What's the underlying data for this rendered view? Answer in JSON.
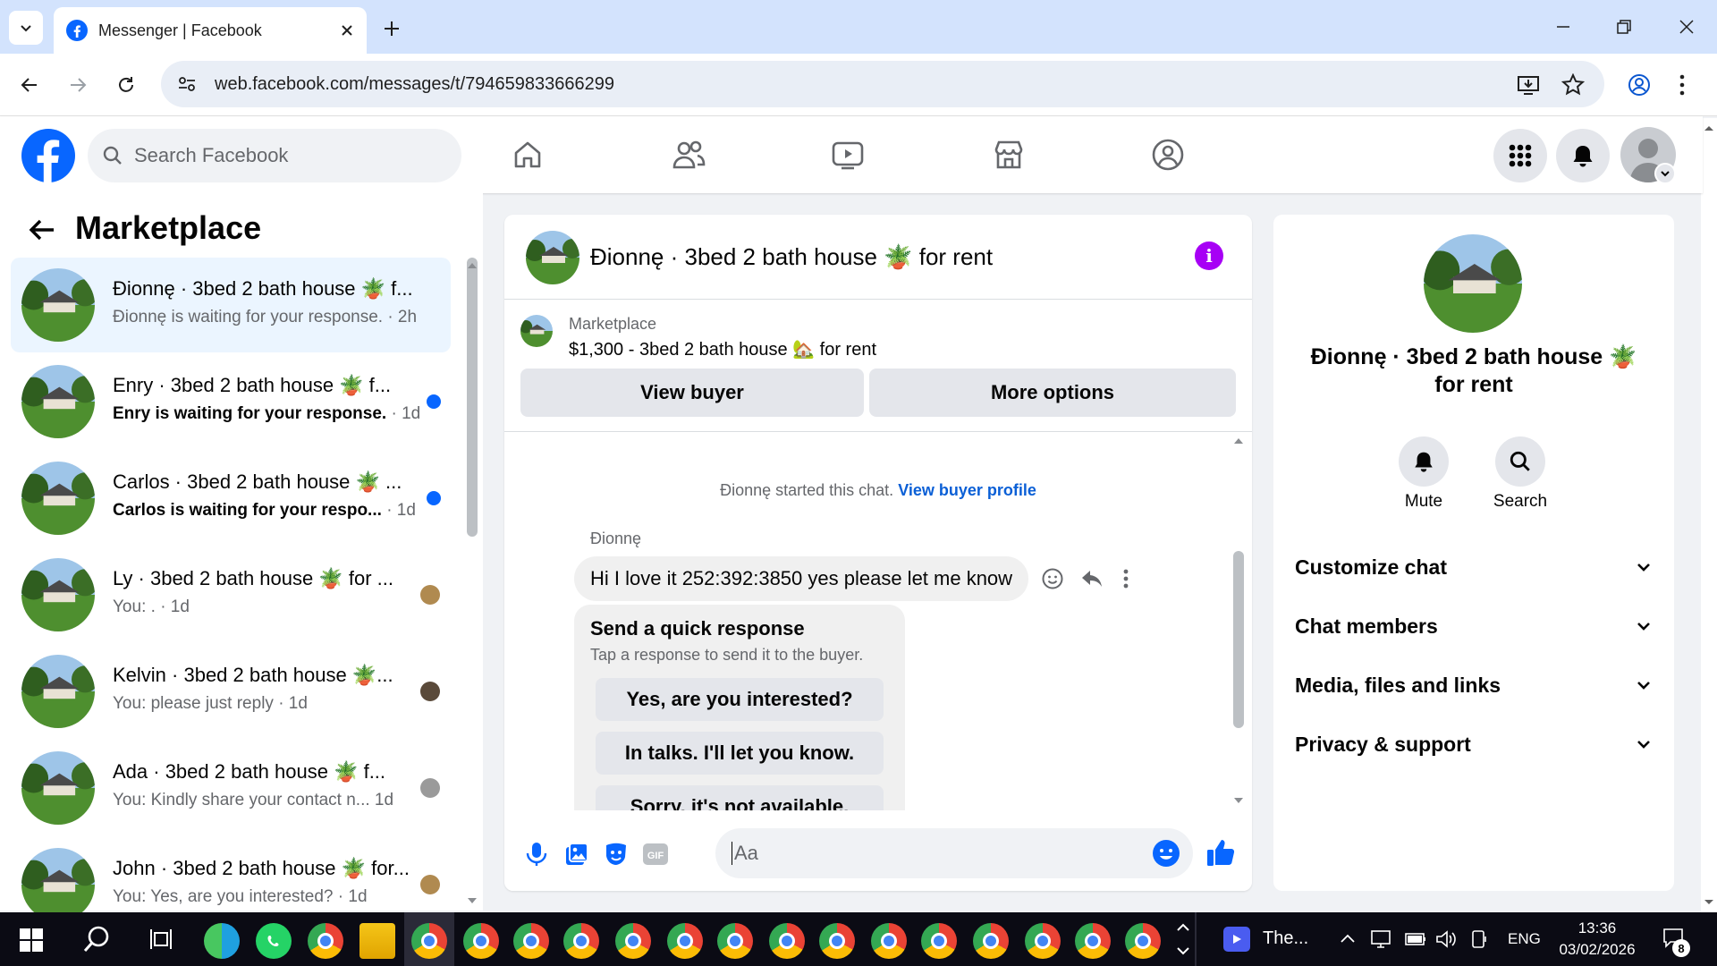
{
  "browser": {
    "tab_title": "Messenger | Facebook",
    "url": "web.facebook.com/messages/t/794659833666299"
  },
  "fb": {
    "search_placeholder": "Search Facebook"
  },
  "sidebar": {
    "title": "Marketplace",
    "conversations": [
      {
        "name": "Đionnę · 3bed 2 bath house 🪴 f...",
        "preview": "Đionnę is waiting for your response.",
        "time": "· 2h",
        "unread": false,
        "active": true
      },
      {
        "name": "Enry · 3bed 2 bath house 🪴 f...",
        "preview": "Enry is waiting for your response.",
        "time": "· 1d",
        "unread": true,
        "active": false
      },
      {
        "name": "Carlos · 3bed 2 bath house 🪴 ...",
        "preview": "Carlos is waiting for your respo...",
        "time": "· 1d",
        "unread": true,
        "active": false
      },
      {
        "name": "Ly · 3bed 2 bath house 🪴 for ...",
        "preview": "You: .",
        "time": "· 1d",
        "unread": false,
        "active": false
      },
      {
        "name": "Kelvin · 3bed 2 bath house 🪴...",
        "preview": "You: please just reply",
        "time": "· 1d",
        "unread": false,
        "active": false
      },
      {
        "name": "Ada · 3bed 2 bath house 🪴 f...",
        "preview": "You: Kindly share your contact n...",
        "time": "1d",
        "unread": false,
        "active": false
      },
      {
        "name": "John · 3bed 2 bath house 🪴 for...",
        "preview": "You: Yes, are you interested?",
        "time": "· 1d",
        "unread": false,
        "active": false
      }
    ]
  },
  "chat": {
    "title": "Đionnę · 3bed 2 bath house 🪴 for rent",
    "listing_source": "Marketplace",
    "listing_title": "$1,300 - 3bed 2 bath house 🏡 for rent",
    "view_buyer_label": "View buyer",
    "more_options_label": "More options",
    "started_text": "Đionnę started this chat.",
    "view_profile_link": "View buyer profile",
    "sender_name": "Đionnę",
    "message": "Hi I love it 252:392:3850 yes please let me know",
    "quick_title": "Send a quick response",
    "quick_subtitle": "Tap a response to send it to the buyer.",
    "quick_responses": [
      "Yes, are you interested?",
      "In talks. I'll let you know.",
      "Sorry, it's not available."
    ],
    "input_placeholder": "Aa"
  },
  "details": {
    "title_line1": "Đionnę · 3bed 2 bath house 🪴",
    "title_line2": "for rent",
    "mute_label": "Mute",
    "search_label": "Search",
    "sections": [
      "Customize chat",
      "Chat members",
      "Media, files and links",
      "Privacy & support"
    ]
  },
  "taskbar": {
    "app_label": "The...",
    "lang": "ENG",
    "time": "13:36",
    "date": "03/02/2026",
    "notif_count": "8"
  },
  "colors": {
    "fb_blue": "#0866ff",
    "info_purple": "#a700f5",
    "active_row": "#ebf5ff"
  }
}
